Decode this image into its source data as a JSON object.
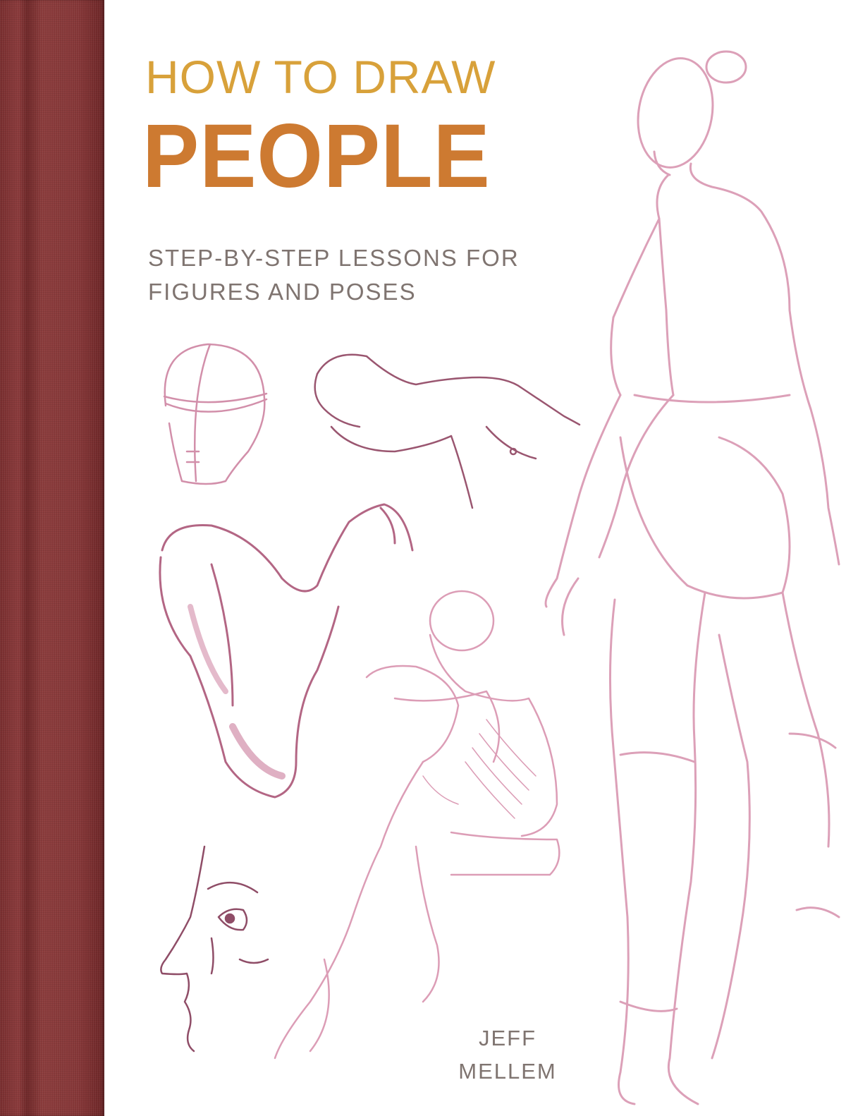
{
  "cover": {
    "title_line1": "HOW TO DRAW",
    "title_line2": "PEOPLE",
    "subtitle_line1": "STEP-BY-STEP LESSONS FOR",
    "subtitle_line2": "FIGURES AND POSES",
    "author_first": "JEFF",
    "author_last": "MELLEM"
  },
  "colors": {
    "title_line1": "#d8a13a",
    "title_line2": "#cd7a31",
    "subtitle": "#7f7470",
    "author": "#7f7470",
    "spine": "#7e3233",
    "sketch_pink": "#dca0b8",
    "sketch_maroon": "#9a5670"
  }
}
